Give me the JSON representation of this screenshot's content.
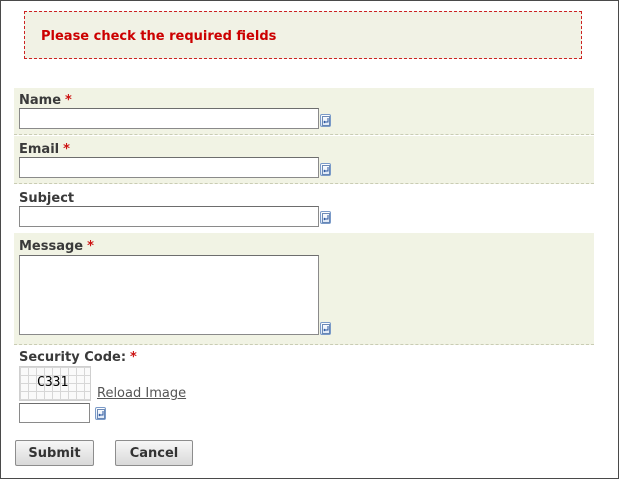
{
  "alert": {
    "message": "Please check the required fields"
  },
  "fields": {
    "name": {
      "label": "Name",
      "required_mark": "*",
      "value": ""
    },
    "email": {
      "label": "Email",
      "required_mark": "*",
      "value": ""
    },
    "subject": {
      "label": "Subject",
      "value": ""
    },
    "message": {
      "label": "Message",
      "required_mark": "*",
      "value": ""
    },
    "security": {
      "label": "Security Code:",
      "required_mark": "*",
      "captcha_text": "C331",
      "reload_label": "Reload Image",
      "value": ""
    }
  },
  "buttons": {
    "submit": "Submit",
    "cancel": "Cancel"
  },
  "icons": {
    "virtual_keyboard": "keyboard-icon"
  },
  "colors": {
    "error": "#cc0000",
    "row_bg": "#f1f3e4",
    "link": "#555555"
  }
}
